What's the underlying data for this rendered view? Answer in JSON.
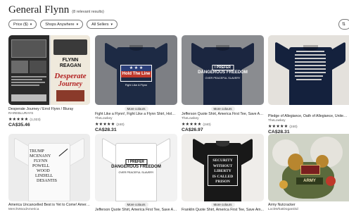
{
  "header": {
    "title": "General Flynn",
    "results": "(8 relevant results)"
  },
  "filters": [
    {
      "label": "Price ($)"
    },
    {
      "label": "Shops Anywhere"
    },
    {
      "label": "All Sellers"
    }
  ],
  "sort": {
    "icon": "sort-icon",
    "glyph": "⇅"
  },
  "row1": [
    {
      "title": "Desperate Journey / Errol Flynn / Bluray",
      "shop": "RAREBLURAYS",
      "stars": "★★★★★",
      "reviews": "(1,023)",
      "price": "CA$35.46",
      "poster_text": [
        "FLYNN",
        "REAGAN",
        "Desperate",
        "Journey"
      ]
    },
    {
      "badge": "More colours",
      "title": "Fight Like a Flynn!, Fight Like a Flynn Shirt, Hold t...",
      "shop": "TheLowkey",
      "stars": "★★★★★",
      "reviews": "(240)",
      "price": "CA$28.31",
      "art": [
        "Hold The Line",
        "Fight Like A Flynn"
      ]
    },
    {
      "badge": "More colours",
      "title": "Jefferson Quote Shirt, America First Tee, Save Am...",
      "shop": "TheLowkey",
      "stars": "★★★★★",
      "reviews": "(240)",
      "price": "CA$26.97",
      "art": [
        "I PREFER",
        "DANGEROUS FREEDOM",
        "OVER PEACEFUL SLAVERY"
      ]
    },
    {
      "title": "Pledge of Allegiance, Oath of Allegiance, United ...",
      "shop": "TheLowkey",
      "stars": "★★★★★",
      "reviews": "(240)",
      "price": "CA$28.31"
    }
  ],
  "row2": [
    {
      "title": "America Uncancelled Best is Yet to Come! Ameri...",
      "shop": "MerchWoodAmerica",
      "art": [
        "TRUMP",
        "MCENANY",
        "FLYNN",
        "POWELL",
        "WOOD",
        "LINDELL",
        "DESANTIS"
      ]
    },
    {
      "badge": "More colours",
      "title": "Jefferson Quote Shirt, America First Tee, Save Am...",
      "art": [
        "I PREFER",
        "DANGEROUS FREEDOM",
        "OVER PEACEFUL SLAVERY"
      ]
    },
    {
      "badge": "More colours",
      "title": "Franklin Quote Shirt, America First Tee, Save Am...",
      "art": [
        "SECURITY",
        "WITHOUT",
        "LIBERTY",
        "IS CALLED",
        "PRISON"
      ]
    },
    {
      "title": "Army Nutcracker",
      "shop": "LockWhatDoganDid",
      "art": [
        "ARMY"
      ]
    }
  ],
  "colors": {
    "navy": "#1d2a44",
    "white_shirt": "#f4f4f4",
    "black_shirt": "#181818",
    "bg_grey": "#7d7f84",
    "flag_red": "#c0392b"
  }
}
